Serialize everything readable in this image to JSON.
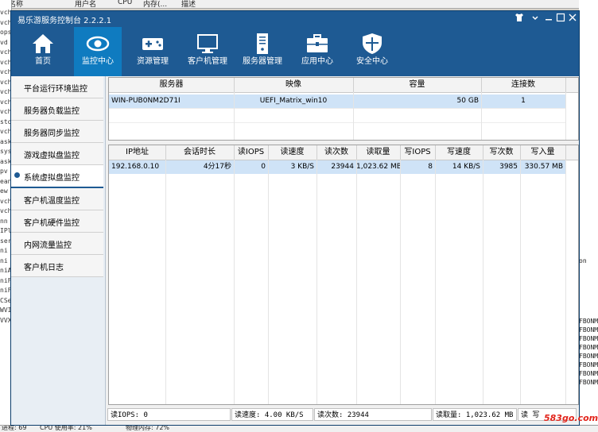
{
  "background": {
    "top_headers": [
      "程名称",
      "用户名",
      "CPU",
      "内存(...",
      "描述"
    ],
    "left_lines": [
      "vch",
      "vch",
      "ops",
      "vd",
      "vch",
      "vch",
      "vch",
      "vch",
      "vch",
      "vch",
      "vch",
      "sto",
      "vch",
      "ask",
      "sys",
      "ask",
      "pv",
      "ean",
      "ew",
      "vch",
      "vch",
      "nn",
      "IPl",
      "ser",
      "ni",
      "ni",
      "niA",
      "niF",
      "niF",
      "CSe",
      "WVI",
      "VVX"
    ],
    "right_lines": [
      "on",
      "FBONM",
      "FBONM",
      "FBONM",
      "FBONM",
      "FBONM",
      "FBONM",
      "FBONM",
      "FBONM"
    ],
    "bottom_text": [
      "进程: 69",
      "CPU 使用率: 21%",
      "物理内存: 72%"
    ]
  },
  "window": {
    "title": "易乐游服务控制台 2.2.2.1",
    "controls": [
      "shirt-icon",
      "minimize-icon",
      "maximize-icon",
      "close-icon"
    ]
  },
  "nav": [
    {
      "label": "首页",
      "icon": "home-icon"
    },
    {
      "label": "监控中心",
      "icon": "eye-icon",
      "active": true
    },
    {
      "label": "资源管理",
      "icon": "gamepad-icon"
    },
    {
      "label": "客户机管理",
      "icon": "monitor-icon"
    },
    {
      "label": "服务器管理",
      "icon": "server-icon"
    },
    {
      "label": "应用中心",
      "icon": "toolbox-icon"
    },
    {
      "label": "安全中心",
      "icon": "shield-icon"
    }
  ],
  "sidebar": [
    {
      "label": "平台运行环境监控"
    },
    {
      "label": "服务器负载监控"
    },
    {
      "label": "服务器同步监控"
    },
    {
      "label": "游戏虚拟盘监控"
    },
    {
      "label": "系统虚拟盘监控",
      "active": true
    },
    {
      "label": "客户机温度监控"
    },
    {
      "label": "客户机硬件监控"
    },
    {
      "label": "内网流量监控"
    },
    {
      "label": "客户机日志"
    }
  ],
  "server_table": {
    "headers": [
      "服务器",
      "映像",
      "容量",
      "连接数"
    ],
    "rows": [
      [
        "WIN-PUB0NM2D71I",
        "UEFI_Matrix_win10",
        "50 GB",
        "1"
      ]
    ]
  },
  "client_table": {
    "headers": [
      "IP地址",
      "会话时长",
      "读IOPS",
      "读速度",
      "读次数",
      "读取量",
      "写IOPS",
      "写速度",
      "写次数",
      "写入量"
    ],
    "rows": [
      [
        "192.168.0.10",
        "4分17秒",
        "0",
        "3 KB/S",
        "23944",
        "1,023.62 MB",
        "8",
        "14 KB/S",
        "3985",
        "330.57 MB"
      ]
    ]
  },
  "status": {
    "read_iops": "读IOPS: 0",
    "read_speed": "读速度: 4.00 KB/S",
    "read_count": "读次数: 23944",
    "read_amount": "读取量: 1,023.62 MB",
    "extra": "读 写"
  },
  "watermark": "583go.com",
  "colors": {
    "primary": "#1e5a93",
    "active_nav": "#0f7bc0",
    "selected_row": "#cfe3f7"
  }
}
